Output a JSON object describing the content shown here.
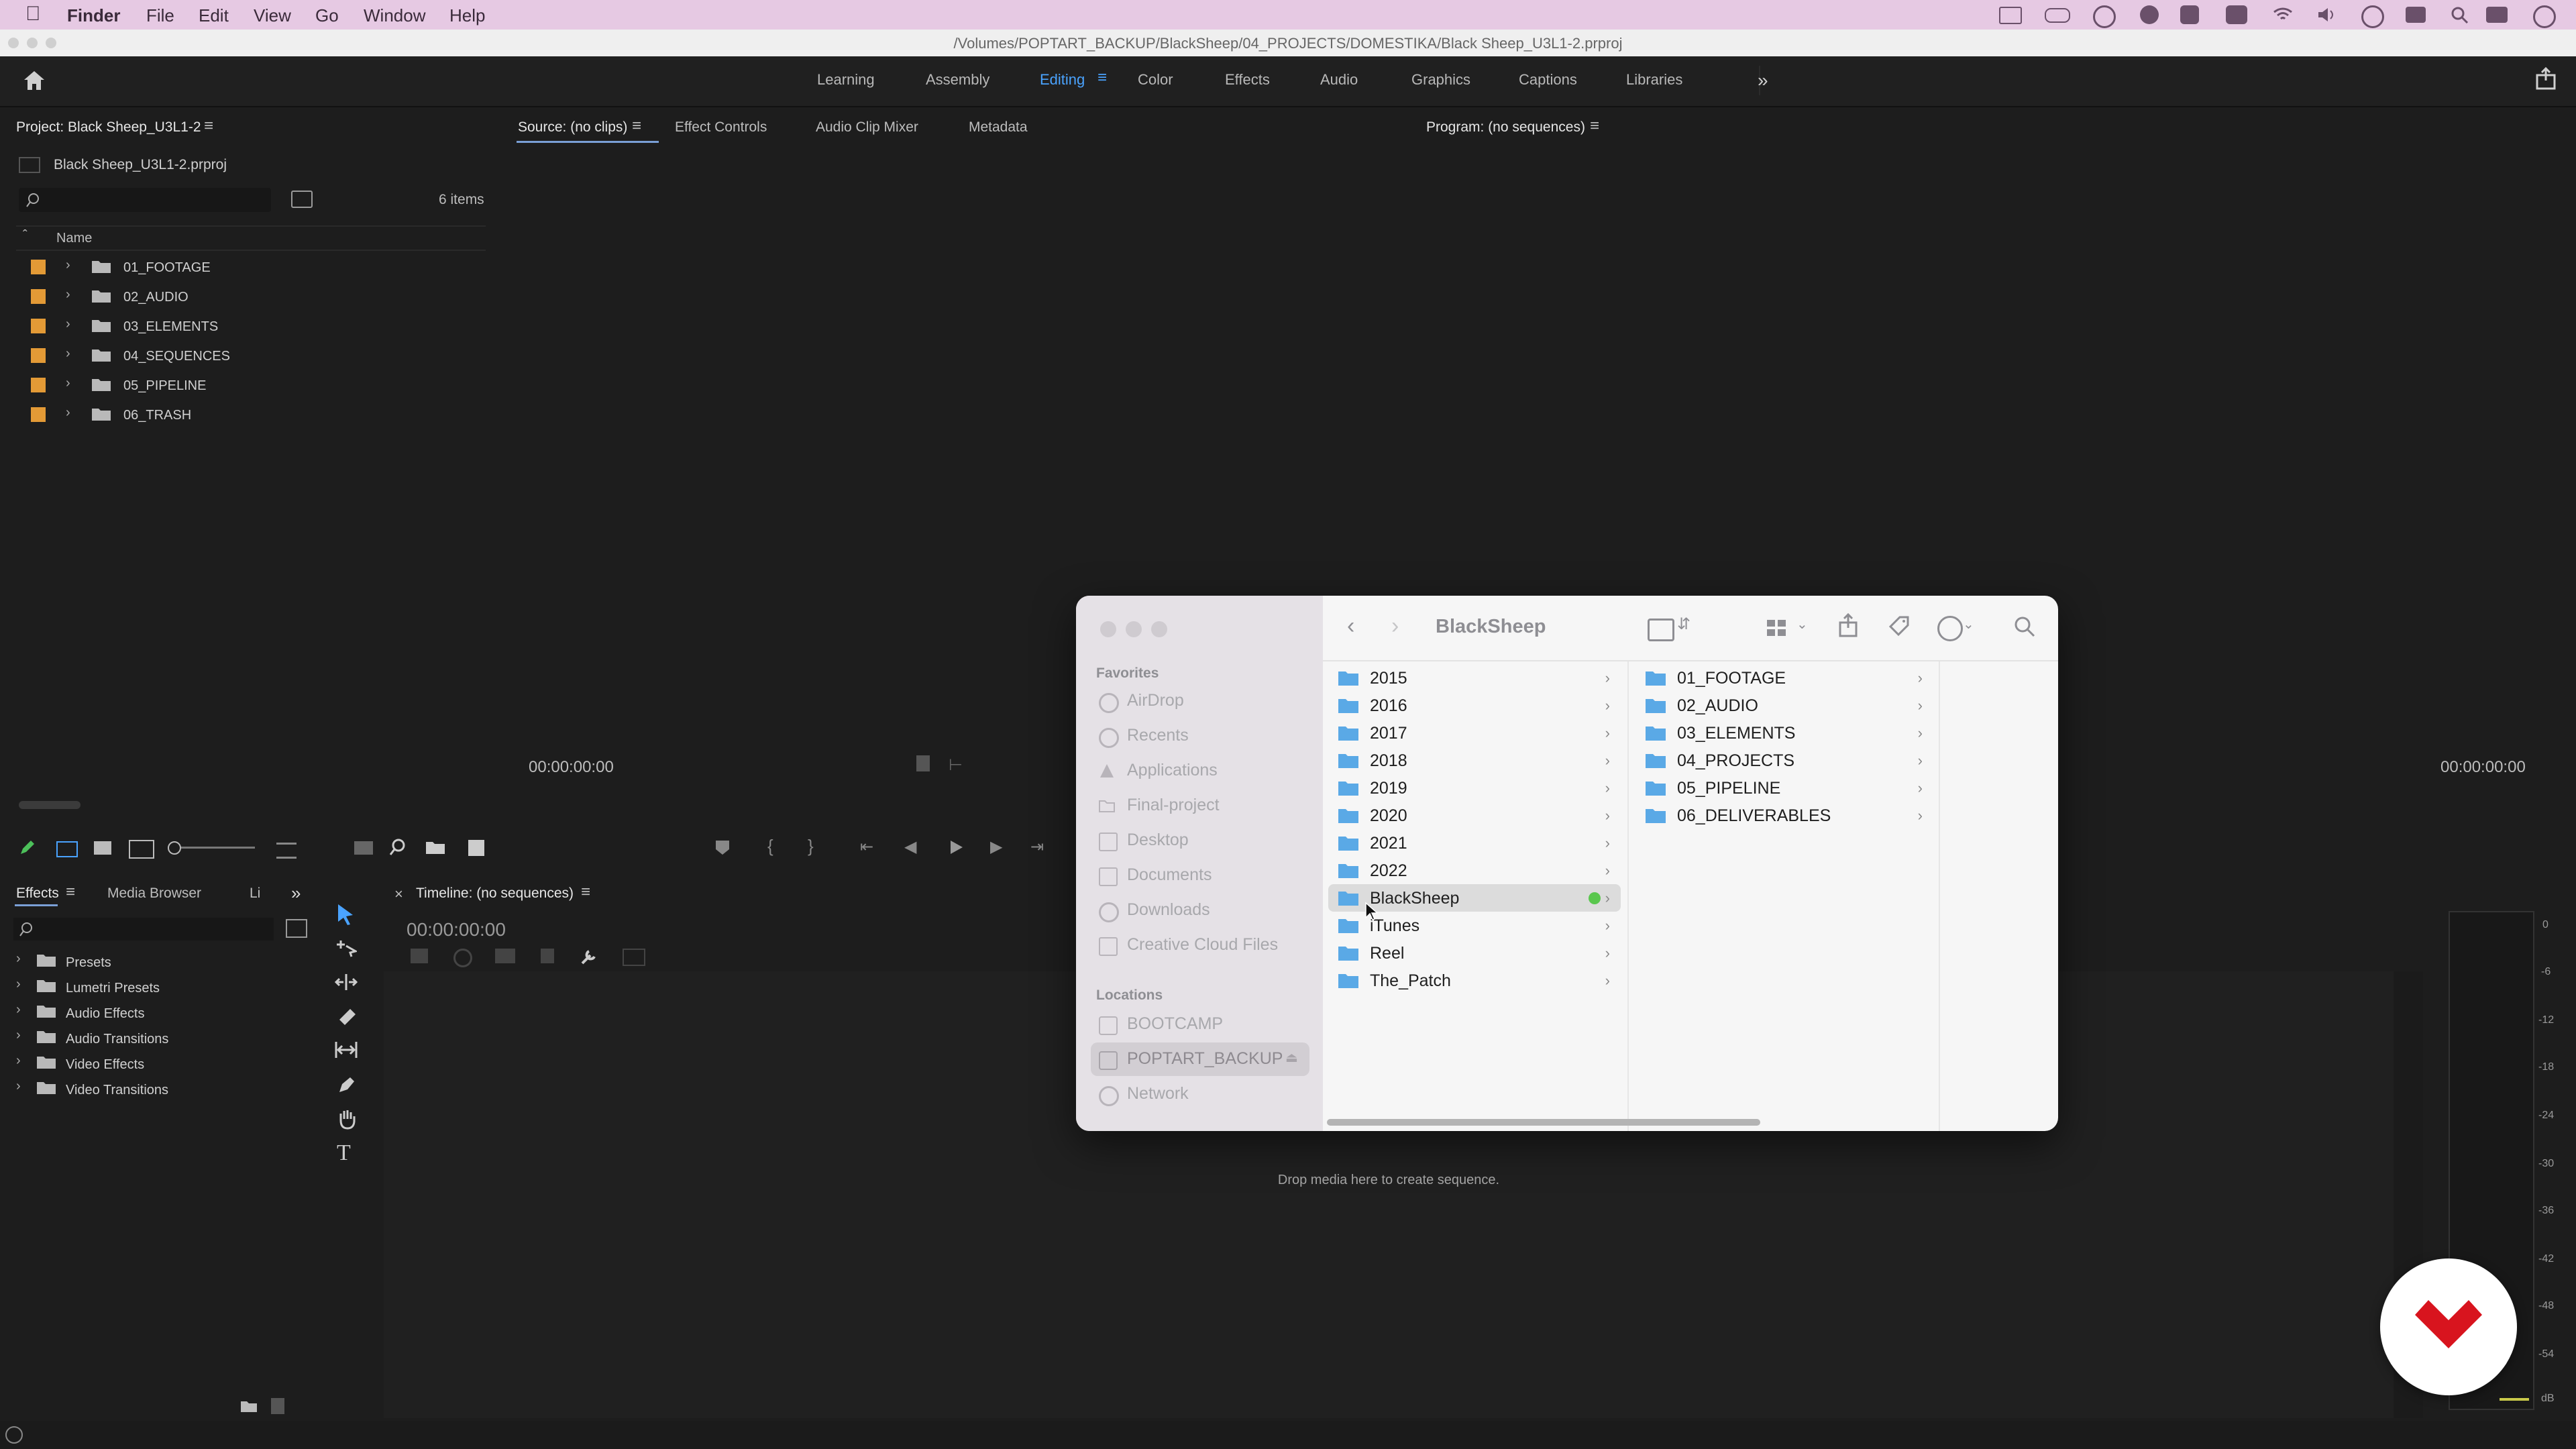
{
  "menubar": {
    "app": "Finder",
    "items": [
      "File",
      "Edit",
      "View",
      "Go",
      "Window",
      "Help"
    ]
  },
  "titlebar": {
    "path": "/Volumes/POPTART_BACKUP/BlackSheep/04_PROJECTS/DOMESTIKA/Black Sheep_U3L1-2.prproj"
  },
  "workspaces": {
    "tabs": [
      "Learning",
      "Assembly",
      "Editing",
      "Color",
      "Effects",
      "Audio",
      "Graphics",
      "Captions",
      "Libraries"
    ],
    "active": "Editing"
  },
  "project": {
    "title": "Project: Black Sheep_U3L1-2",
    "file": "Black Sheep_U3L1-2.prproj",
    "count": "6 items",
    "col_name": "Name",
    "items": [
      "01_FOOTAGE",
      "02_AUDIO",
      "03_ELEMENTS",
      "04_SEQUENCES",
      "05_PIPELINE",
      "06_TRASH"
    ],
    "label_color": "#e39a36"
  },
  "source": {
    "tabs": [
      "Source: (no clips)",
      "Effect Controls",
      "Audio Clip Mixer",
      "Metadata"
    ],
    "timecode": "00:00:00:00"
  },
  "program": {
    "title": "Program: (no sequences)",
    "timecode": "00:00:00:00"
  },
  "effects": {
    "tabs": [
      "Effects",
      "Media Browser",
      "Li"
    ],
    "items": [
      "Presets",
      "Lumetri Presets",
      "Audio Effects",
      "Audio Transitions",
      "Video Effects",
      "Video Transitions"
    ]
  },
  "timeline": {
    "title": "Timeline: (no sequences)",
    "timecode": "00:00:00:00",
    "drop_hint": "Drop media here to create sequence."
  },
  "meter": {
    "scale": [
      "0",
      "-6",
      "-12",
      "-18",
      "-24",
      "-30",
      "-36",
      "-42",
      "-48",
      "-54",
      "dB"
    ]
  },
  "finder": {
    "title": "BlackSheep",
    "favorites_header": "Favorites",
    "favorites": [
      "AirDrop",
      "Recents",
      "Applications",
      "Final-project",
      "Desktop",
      "Documents",
      "Downloads",
      "Creative Cloud Files"
    ],
    "locations_header": "Locations",
    "locations": [
      "BOOTCAMP",
      "POPTART_BACKUP",
      "Network"
    ],
    "column1": [
      "2015",
      "2016",
      "2017",
      "2018",
      "2019",
      "2020",
      "2021",
      "2022",
      "BlackSheep",
      "iTunes",
      "Reel",
      "The_Patch"
    ],
    "selected": "BlackSheep",
    "tag_color": "#5ac74e",
    "column2": [
      "01_FOOTAGE",
      "02_AUDIO",
      "03_ELEMENTS",
      "04_PROJECTS",
      "05_PIPELINE",
      "06_DELIVERABLES"
    ],
    "folder_color": "#5aa9e6"
  },
  "brand": {
    "color": "#d8141e"
  }
}
